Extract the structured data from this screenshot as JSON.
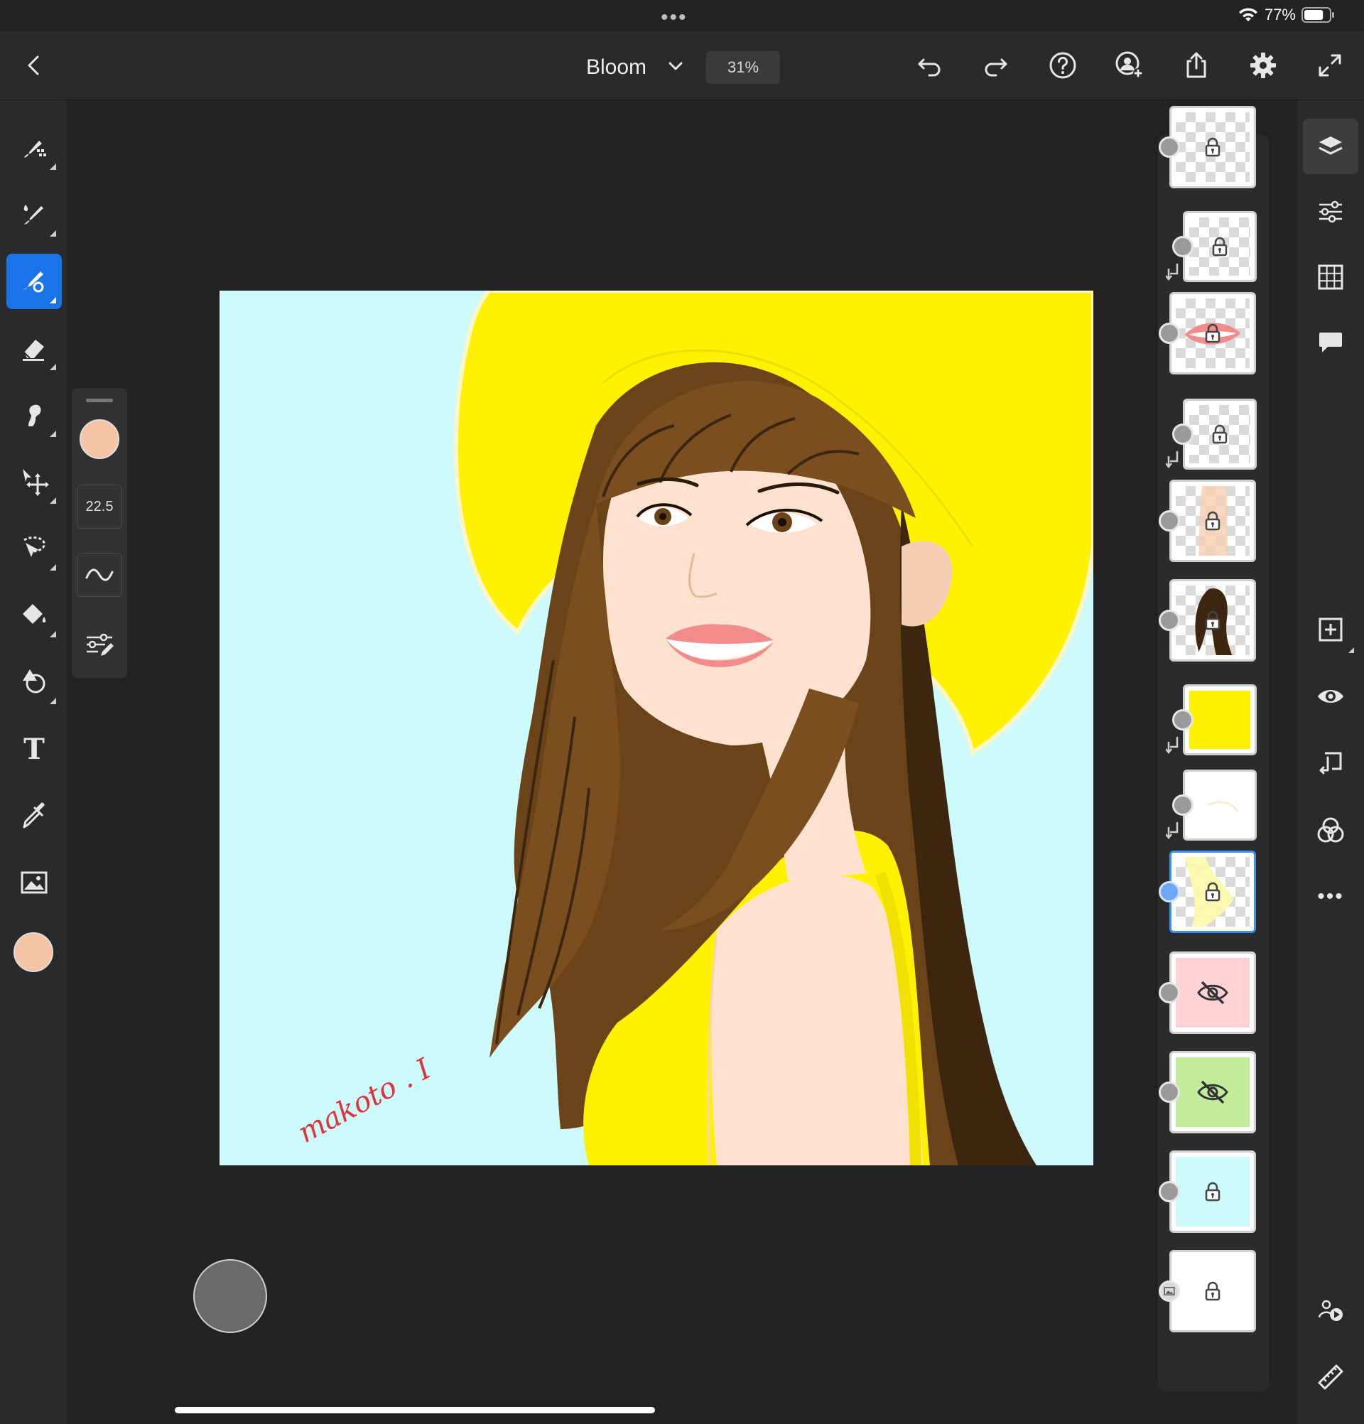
{
  "status_bar": {
    "battery_percent": "77%",
    "battery_level": 0.77,
    "menu_dots": "•••"
  },
  "header": {
    "document_title": "Bloom",
    "zoom_level": "31%",
    "buttons": [
      "back-icon",
      "undo-icon",
      "redo-icon",
      "help-icon",
      "invite-icon",
      "share-icon",
      "settings-icon",
      "fullscreen-icon"
    ]
  },
  "left_toolbar": {
    "tools": [
      "pixel-brush-icon",
      "live-brush-icon",
      "vector-brush-icon",
      "eraser-icon",
      "smudge-icon",
      "transform-icon",
      "selection-icon",
      "fill-icon",
      "shapes-icon",
      "text-icon",
      "eyedropper-icon",
      "image-icon"
    ],
    "active_tool": "vector-brush-icon",
    "text_tool_glyph": "T",
    "current_color": "#f5c4a4"
  },
  "brush_panel": {
    "color": "#f5c4a4",
    "size": "22.5",
    "items": [
      "color-swatch",
      "brush-size",
      "smoothing-icon",
      "brush-settings-icon"
    ]
  },
  "canvas": {
    "background_color": "#cdfafb",
    "signature_text": "makoto . I"
  },
  "layers": {
    "items": [
      {
        "name": "layer-1",
        "kind": "transparent",
        "locked": true,
        "visible": true,
        "clipped": false
      },
      {
        "name": "layer-2",
        "kind": "transparent",
        "locked": true,
        "visible": true,
        "clipped": true
      },
      {
        "name": "layer-lips",
        "kind": "lips",
        "locked": true,
        "visible": true,
        "clipped": false
      },
      {
        "name": "layer-4",
        "kind": "transparent",
        "locked": true,
        "visible": true,
        "clipped": true
      },
      {
        "name": "layer-skin",
        "kind": "skin",
        "locked": true,
        "visible": true,
        "clipped": false
      },
      {
        "name": "layer-hair",
        "kind": "hair",
        "locked": true,
        "visible": true,
        "clipped": false
      },
      {
        "name": "layer-yellow",
        "kind": "yellow",
        "locked": false,
        "visible": true,
        "clipped": true
      },
      {
        "name": "layer-white",
        "kind": "white",
        "locked": false,
        "visible": true,
        "clipped": true
      },
      {
        "name": "layer-dress",
        "kind": "dress",
        "locked": true,
        "visible": true,
        "clipped": false,
        "active": true
      },
      {
        "name": "layer-pink",
        "kind": "pink",
        "locked": false,
        "visible": false,
        "clipped": false
      },
      {
        "name": "layer-green",
        "kind": "green",
        "locked": false,
        "visible": false,
        "clipped": false
      },
      {
        "name": "layer-cyan",
        "kind": "cyan",
        "locked": true,
        "visible": true,
        "clipped": false
      },
      {
        "name": "layer-background",
        "kind": "background",
        "locked": true,
        "visible": true,
        "clipped": false
      }
    ]
  },
  "right_toolbar": {
    "tools": [
      "layers-icon",
      "layer-properties-icon",
      "grid-icon",
      "comments-icon",
      "add-layer-icon",
      "visibility-icon",
      "merge-down-icon",
      "blend-icon",
      "more-icon",
      "livestream-icon",
      "ruler-icon"
    ],
    "active_tool": "layers-icon",
    "more_glyph": "•••"
  },
  "colors": {
    "accent": "#1a73e8",
    "app_background": "#222222",
    "panel_background": "#2a2a2a",
    "hat_yellow": "#fff200",
    "hair_brown": "#5a3a16",
    "skin": "#fde3cf",
    "lips": "#f28b8b",
    "sky": "#cdfafb",
    "signature_red": "#e0323a"
  }
}
